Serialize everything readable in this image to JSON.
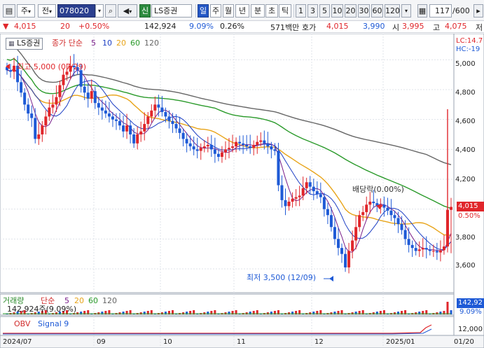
{
  "toolbar": {
    "period_selector": "주",
    "prev_label": "전",
    "code": "078020",
    "market_badge": "신",
    "stock_name": "LS증권",
    "periods": [
      "일",
      "주",
      "월",
      "년",
      "분",
      "초",
      "틱"
    ],
    "active_period": "일",
    "intervals": [
      "1",
      "3",
      "5",
      "10",
      "20",
      "30",
      "60",
      "120"
    ],
    "page_count": "117",
    "page_total": "/600"
  },
  "quote": {
    "price": "4,015",
    "change": "20",
    "change_pct": "+0.50%",
    "volume": "142,924",
    "turnover_pct": "9.09%",
    "ratio": "0.26%",
    "trade_value": "571백만",
    "ask_label": "호가",
    "ask": "4,015",
    "bid": "3,990",
    "open_label": "시",
    "open": "3,995",
    "high_label": "고",
    "high": "4,075",
    "low_label": "저"
  },
  "price_panel": {
    "title": "LS증권",
    "legend_prefix": "종가 단순",
    "ma_periods": [
      "5",
      "10",
      "20",
      "60",
      "120"
    ],
    "ma_colors": [
      "#7a1f8a",
      "#1d3fc4",
      "#e8a419",
      "#2a9a2a",
      "#666666"
    ],
    "lc_label": "LC:14.7",
    "hc_label": "HC:-19",
    "high_annotation": "최고 5,000 (07/29)",
    "low_annotation": "최저 3,500 (12/09)",
    "dividend_annotation": "배당락(0.00%)",
    "current_price_tag": "4,015",
    "current_pct_tag": "0.50%"
  },
  "volume_panel": {
    "legend_prefix": "거래량",
    "legend_type": "단순",
    "ma_periods": [
      "5",
      "20",
      "60",
      "120"
    ],
    "value_label": "142,924주(9.09%)",
    "right_value": "142,92",
    "right_pct": "9.09%"
  },
  "obv_panel": {
    "legend": "OBV",
    "signal": "Signal 9",
    "right_value": "12,000"
  },
  "x_labels": [
    "2024/07",
    "09",
    "10",
    "11",
    "12",
    "2025/01",
    "01/20"
  ],
  "chart_data": {
    "type": "candlestick",
    "y_axis": {
      "ticks": [
        3600,
        3800,
        4000,
        4200,
        4400,
        4600,
        4800,
        5000
      ],
      "range": [
        3450,
        5100
      ]
    },
    "x_axis": {
      "labels": [
        "2024/07",
        "09",
        "10",
        "11",
        "12",
        "2025/01",
        "01/20"
      ]
    },
    "last": {
      "open": 3995,
      "high": 4075,
      "low": 3705,
      "close": 4015
    },
    "high_point": 5000,
    "low_point": 3500,
    "candles_close": [
      4930,
      4920,
      4960,
      4850,
      4780,
      4700,
      4640,
      4610,
      4470,
      4500,
      4560,
      4620,
      4680,
      4700,
      4750,
      4830,
      4900,
      4920,
      4960,
      4950,
      4930,
      4820,
      4780,
      4740,
      4790,
      4710,
      4680,
      4660,
      4640,
      4620,
      4600,
      4590,
      4560,
      4520,
      4560,
      4500,
      4440,
      4500,
      4520,
      4570,
      4620,
      4660,
      4700,
      4680,
      4650,
      4620,
      4590,
      4570,
      4540,
      4510,
      4470,
      4440,
      4420,
      4400,
      4390,
      4410,
      4420,
      4430,
      4400,
      4370,
      4350,
      4380,
      4400,
      4410,
      4420,
      4450,
      4440,
      4430,
      4420,
      4410,
      4430,
      4450,
      4460,
      4440,
      4420,
      4400,
      4390,
      4160,
      4060,
      4020,
      4050,
      4070,
      4080,
      4090,
      4140,
      4180,
      4150,
      4120,
      4100,
      4080,
      4000,
      3960,
      3880,
      3800,
      3740,
      3700,
      3610,
      3720,
      3790,
      3880,
      3960,
      3980,
      4030,
      4050,
      4040,
      4020,
      4030,
      4010,
      3990,
      3960,
      3940,
      3900,
      3860,
      3800,
      3760,
      3740,
      3720,
      3730,
      3740,
      3730,
      3720,
      3720,
      3710,
      3725,
      3750,
      3995,
      4015
    ],
    "ma_series": [
      "MA5",
      "MA10",
      "MA20",
      "MA60",
      "MA120"
    ],
    "volume_last": 142924,
    "obv_range": [
      0,
      12000
    ]
  }
}
